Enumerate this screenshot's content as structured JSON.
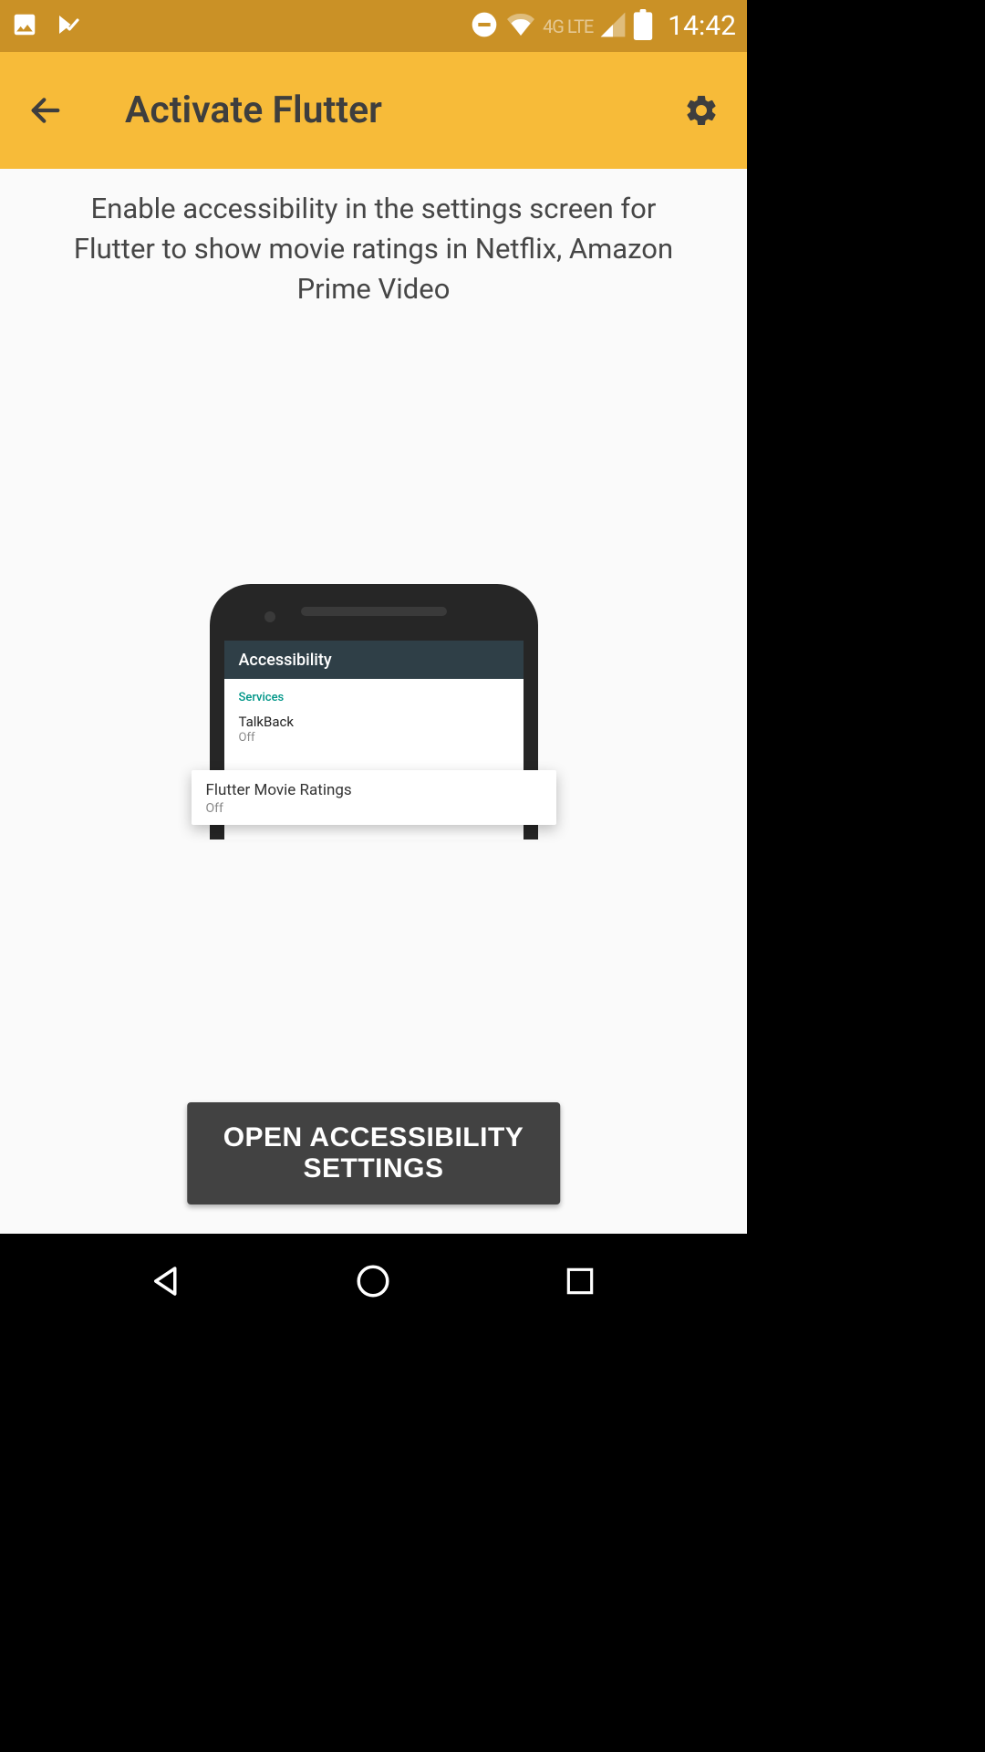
{
  "status_bar": {
    "time": "14:42",
    "signal_label": "4G LTE"
  },
  "app_bar": {
    "title": "Activate Flutter"
  },
  "content": {
    "instructions": "Enable accessibility in the settings screen for Flutter to show movie ratings in Netflix, Amazon Prime Video"
  },
  "phone_illustration": {
    "header": "Accessibility",
    "section_label": "Services",
    "items": [
      {
        "title": "TalkBack",
        "subtitle": "Off"
      }
    ],
    "popup": {
      "title": "Flutter Movie Ratings",
      "subtitle": "Off"
    }
  },
  "button": {
    "open_accessibility": "OPEN ACCESSIBILITY SETTINGS"
  }
}
